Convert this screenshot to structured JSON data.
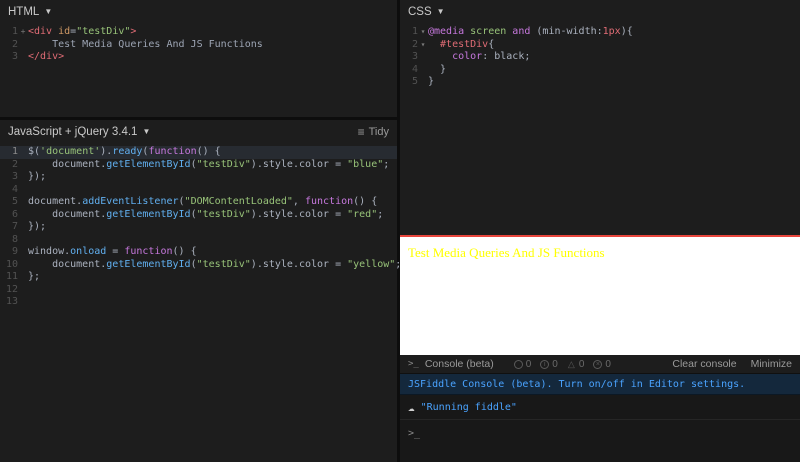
{
  "icons": {
    "caret": "▼",
    "hamburger": "≡",
    "cloud": "☁",
    "prompt": ">_"
  },
  "panels": {
    "html": {
      "title": "HTML",
      "code": [
        {
          "n": 1,
          "fold": "+",
          "tokens": [
            [
              "tag",
              "<div"
            ],
            [
              "plain",
              " "
            ],
            [
              "attr",
              "id"
            ],
            [
              "plain",
              "="
            ],
            [
              "string",
              "\"testDiv\""
            ],
            [
              "tag",
              ">"
            ]
          ]
        },
        {
          "n": 2,
          "tokens": [
            [
              "text",
              "    Test Media Queries And JS Functions"
            ]
          ]
        },
        {
          "n": 3,
          "tokens": [
            [
              "tag",
              "</div>"
            ]
          ]
        }
      ]
    },
    "css": {
      "title": "CSS",
      "code": [
        {
          "n": 1,
          "fold": "▾",
          "tokens": [
            [
              "keyword",
              "@media"
            ],
            [
              "plain",
              " "
            ],
            [
              "string",
              "screen"
            ],
            [
              "keyword",
              " and "
            ],
            [
              "plain",
              "("
            ],
            [
              "plain",
              "min-width:"
            ],
            [
              "num",
              "1px"
            ],
            [
              "plain",
              "){"
            ]
          ]
        },
        {
          "n": 2,
          "fold": "▾",
          "tokens": [
            [
              "def",
              "  #testDiv"
            ],
            [
              "plain",
              "{"
            ]
          ]
        },
        {
          "n": 3,
          "tokens": [
            [
              "keyword",
              "    color"
            ],
            [
              "plain",
              ": "
            ],
            [
              "plain",
              "black"
            ],
            [
              "plain",
              ";"
            ]
          ]
        },
        {
          "n": 4,
          "tokens": [
            [
              "plain",
              "  }"
            ]
          ]
        },
        {
          "n": 5,
          "tokens": [
            [
              "plain",
              "}"
            ]
          ]
        }
      ]
    },
    "js": {
      "title": "JavaScript + jQuery 3.4.1",
      "tidy_label": "Tidy",
      "code": [
        {
          "n": 1,
          "active": true,
          "tokens": [
            [
              "plain",
              "$("
            ],
            [
              "string",
              "'document'"
            ],
            [
              "plain",
              ")."
            ],
            [
              "prop",
              "ready"
            ],
            [
              "plain",
              "("
            ],
            [
              "keyword",
              "function"
            ],
            [
              "plain",
              "() {"
            ]
          ]
        },
        {
          "n": 2,
          "tokens": [
            [
              "plain",
              "    document."
            ],
            [
              "prop",
              "getElementById"
            ],
            [
              "plain",
              "("
            ],
            [
              "string",
              "\"testDiv\""
            ],
            [
              "plain",
              ").style.color = "
            ],
            [
              "string",
              "\"blue\""
            ],
            [
              "plain",
              ";"
            ]
          ]
        },
        {
          "n": 3,
          "tokens": [
            [
              "plain",
              "});"
            ]
          ]
        },
        {
          "n": 4,
          "tokens": []
        },
        {
          "n": 5,
          "tokens": [
            [
              "plain",
              "document."
            ],
            [
              "prop",
              "addEventListener"
            ],
            [
              "plain",
              "("
            ],
            [
              "string",
              "\"DOMContentLoaded\""
            ],
            [
              "plain",
              ", "
            ],
            [
              "keyword",
              "function"
            ],
            [
              "plain",
              "() {"
            ]
          ]
        },
        {
          "n": 6,
          "tokens": [
            [
              "plain",
              "    document."
            ],
            [
              "prop",
              "getElementById"
            ],
            [
              "plain",
              "("
            ],
            [
              "string",
              "\"testDiv\""
            ],
            [
              "plain",
              ").style.color = "
            ],
            [
              "string",
              "\"red\""
            ],
            [
              "plain",
              ";"
            ]
          ]
        },
        {
          "n": 7,
          "tokens": [
            [
              "plain",
              "});"
            ]
          ]
        },
        {
          "n": 8,
          "tokens": []
        },
        {
          "n": 9,
          "tokens": [
            [
              "plain",
              "window."
            ],
            [
              "prop",
              "onload"
            ],
            [
              "plain",
              " = "
            ],
            [
              "keyword",
              "function"
            ],
            [
              "plain",
              "() {"
            ]
          ]
        },
        {
          "n": 10,
          "tokens": [
            [
              "plain",
              "    document."
            ],
            [
              "prop",
              "getElementById"
            ],
            [
              "plain",
              "("
            ],
            [
              "string",
              "\"testDiv\""
            ],
            [
              "plain",
              ").style.color = "
            ],
            [
              "string",
              "\"yellow\""
            ],
            [
              "plain",
              ";"
            ]
          ]
        },
        {
          "n": 11,
          "tokens": [
            [
              "plain",
              "};"
            ]
          ]
        },
        {
          "n": 12,
          "tokens": []
        },
        {
          "n": 13,
          "tokens": []
        }
      ]
    },
    "result": {
      "text": "Test Media Queries And JS Functions"
    },
    "console": {
      "title": "Console (beta)",
      "counts": [
        {
          "value": "0"
        },
        {
          "value": "0"
        },
        {
          "value": "0"
        },
        {
          "value": "0"
        }
      ],
      "clear_label": "Clear console",
      "minimize_label": "Minimize",
      "info_message": "JSFiddle Console (beta). Turn on/off in Editor settings.",
      "log_message": "\"Running fiddle\"",
      "input_prompt": ">_"
    }
  }
}
